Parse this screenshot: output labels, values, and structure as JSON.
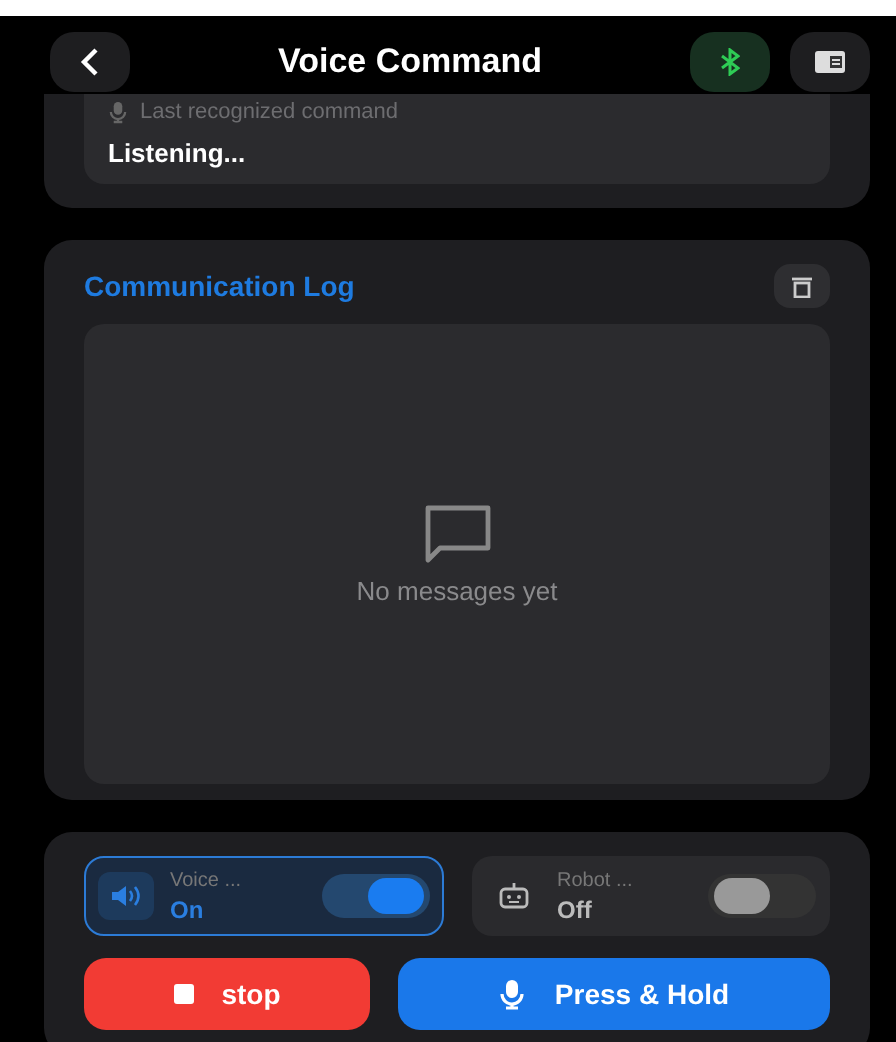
{
  "header": {
    "title": "Voice Command",
    "bluetooth_connected": true
  },
  "status": {
    "label": "Last recognized command",
    "value": "Listening..."
  },
  "log": {
    "title": "Communication Log",
    "empty_text": "No messages yet"
  },
  "toggles": [
    {
      "kind": "voice",
      "label": "Voice ...",
      "state": "On",
      "on": true
    },
    {
      "kind": "robot",
      "label": "Robot ...",
      "state": "Off",
      "on": false
    }
  ],
  "buttons": [
    {
      "kind": "stop",
      "label": "stop"
    },
    {
      "kind": "talk",
      "label": "Press & Hold"
    }
  ]
}
